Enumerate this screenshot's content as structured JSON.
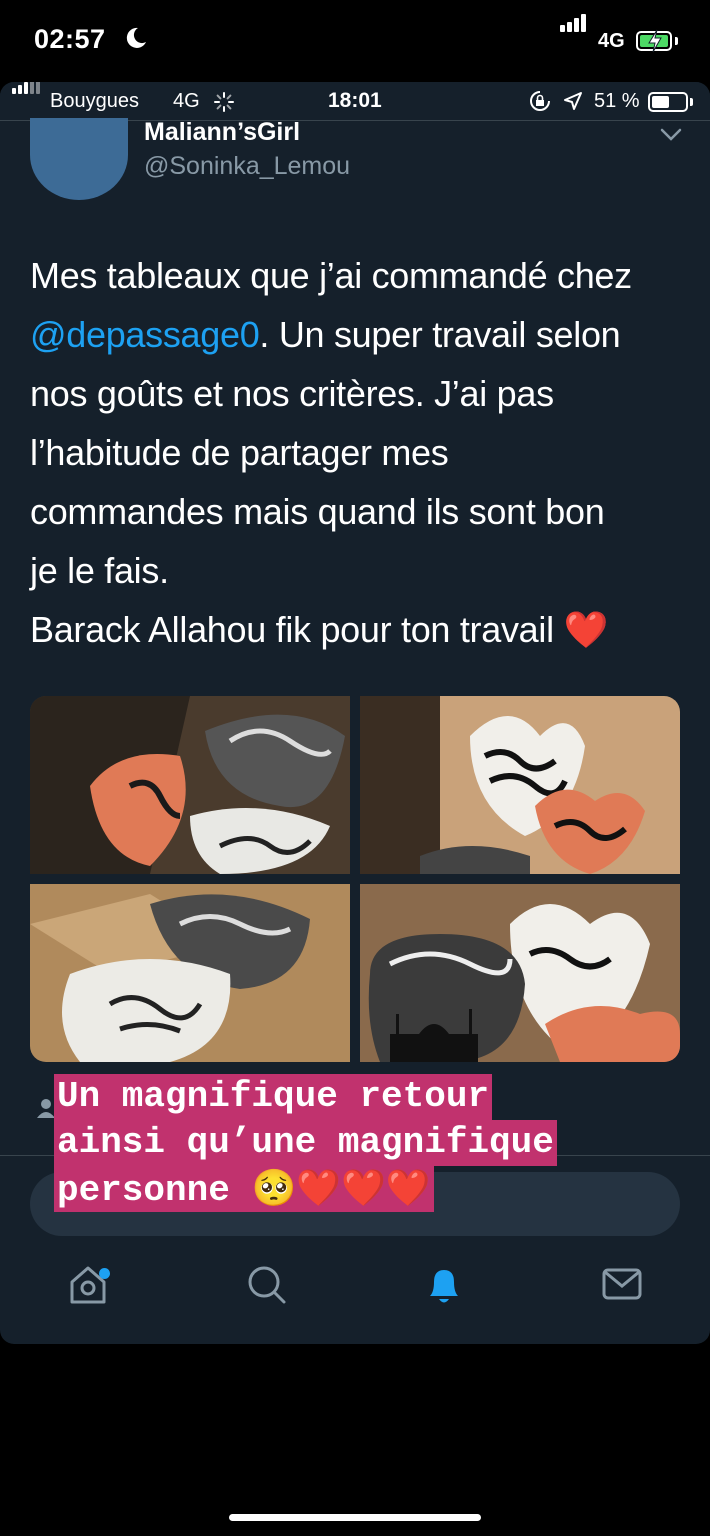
{
  "os_status": {
    "time": "02:57",
    "network": "4G",
    "battery_color": "#4cd964"
  },
  "inner_status": {
    "carrier": "Bouygues",
    "network": "4G",
    "time": "18:01",
    "battery_percent": "51 %"
  },
  "tweet": {
    "display_name": "Maliann’sGirl",
    "handle": "@Soninka_Lemou",
    "lines": [
      {
        "pre": "Mes tableaux que j’ai commandé chez",
        "mention": "",
        "post": ""
      },
      {
        "pre": "",
        "mention": "@depassage0",
        "post": ". Un super travail selon"
      },
      {
        "pre": "nos goûts et nos critères. J’ai pas",
        "mention": "",
        "post": ""
      },
      {
        "pre": "l’habitude de partager mes",
        "mention": "",
        "post": ""
      },
      {
        "pre": "commandes mais quand ils sont bon",
        "mention": "",
        "post": ""
      },
      {
        "pre": "je le fais.",
        "mention": "",
        "post": ""
      },
      {
        "pre": "Barack Allahou fik pour ton travail ",
        "mention": "",
        "post": "",
        "emoji": "❤️"
      }
    ],
    "mention_color": "#1da1f2"
  },
  "caption": {
    "lines": [
      "Un magnifique retour",
      "ainsi qu’une magnifique",
      "personne "
    ],
    "emojis": "🥺❤️❤️❤️",
    "background": "#c1326e"
  },
  "tabs": [
    "home-icon",
    "search-icon",
    "notifications-icon",
    "messages-icon"
  ],
  "theme": {
    "panel_bg": "#15202b",
    "accent": "#1da1f2",
    "muted": "#8899a6"
  }
}
